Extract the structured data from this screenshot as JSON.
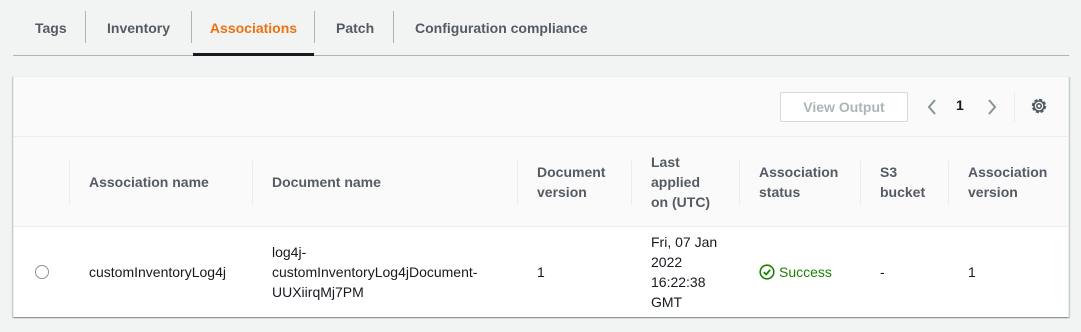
{
  "tabs": [
    {
      "label": "Tags"
    },
    {
      "label": "Inventory"
    },
    {
      "label": "Associations"
    },
    {
      "label": "Patch"
    },
    {
      "label": "Configuration compliance"
    }
  ],
  "toolbar": {
    "view_output_label": "View Output",
    "page_number": "1"
  },
  "table": {
    "headers": {
      "association_name": "Association name",
      "document_name": "Document name",
      "document_version": [
        "Document",
        "version"
      ],
      "last_applied": [
        "Last",
        "applied",
        "on (UTC)"
      ],
      "association_status": [
        "Association",
        "status"
      ],
      "s3_bucket": [
        "S3",
        "bucket"
      ],
      "association_version": [
        "Association",
        "version"
      ]
    },
    "rows": [
      {
        "association_name": "customInventoryLog4j",
        "document_name": [
          "log4j-",
          "customInventoryLog4jDocument-",
          "UUXiirqMj7PM"
        ],
        "document_version": "1",
        "last_applied": [
          "Fri, 07 Jan",
          "2022",
          "16:22:38",
          "GMT"
        ],
        "status": "Success",
        "s3_bucket": "-",
        "association_version": "1"
      }
    ]
  },
  "colors": {
    "active_tab": "#ec7211",
    "success": "#1d8102"
  }
}
